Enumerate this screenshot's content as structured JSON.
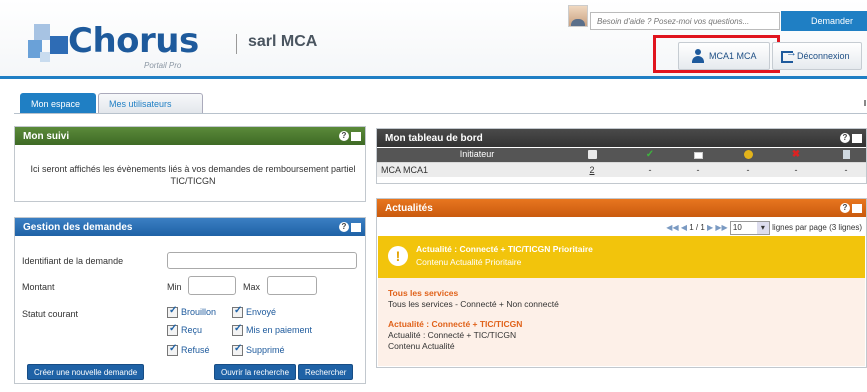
{
  "header": {
    "logo_text": "Chorus",
    "logo_subtitle": "Portail Pro",
    "company": "sarl MCA",
    "help_placeholder": "Besoin d'aide ? Posez-moi vos questions...",
    "help_button": "Demander",
    "user_name": "MCA1 MCA",
    "logout_label": "Déconnexion"
  },
  "tabs": [
    {
      "label": "Mon espace",
      "active": true
    },
    {
      "label": "Mes utilisateurs",
      "active": false
    }
  ],
  "mon_suivi": {
    "title": "Mon suivi",
    "message": "Ici seront affichés les évènements liés à vos demandes de remboursement partiel TIC/TICGN"
  },
  "gestion": {
    "title": "Gestion des demandes",
    "id_label": "Identifiant de la demande",
    "montant_label": "Montant",
    "min_label": "Min",
    "max_label": "Max",
    "statut_label": "Statut courant",
    "statuses": [
      "Brouillon",
      "Envoyé",
      "Reçu",
      "Mis en paiement",
      "Refusé",
      "Supprimé"
    ],
    "create_button": "Créer une nouvelle demande",
    "open_search_button": "Ouvrir la recherche",
    "search_button": "Rechercher"
  },
  "tableau": {
    "title": "Mon tableau de bord",
    "column_header": "Initiateur",
    "column_icons": [
      "document-icon",
      "check-icon",
      "mail-icon",
      "coins-icon",
      "cross-icon",
      "trash-icon"
    ],
    "rows": [
      {
        "initiateur": "MCA MCA1",
        "values": [
          "2",
          "-",
          "-",
          "-",
          "-",
          "-"
        ]
      }
    ]
  },
  "actualites": {
    "title": "Actualités",
    "pager_prefix": "◀◀ ◀ ",
    "pager_pages": "1 / 1",
    "pager_suffix": " ▶ ▶▶",
    "per_page_value": "10",
    "per_page_label": "lignes par page (3 lignes)",
    "priority_title": "Actualité : Connecté + TIC/TICGN Prioritaire",
    "priority_body": "Contenu Actualité Prioritaire",
    "items": [
      {
        "title": "Tous les services",
        "lines": [
          "Tous les services - Connecté + Non connecté"
        ]
      },
      {
        "title": "Actualité : Connecté + TIC/TICGN",
        "lines": [
          "Actualité : Connecté + TIC/TICGN",
          "Contenu Actualité"
        ]
      }
    ]
  },
  "colors": {
    "brand_blue": "#1f7fc4",
    "panel_green": "#4a7a30",
    "panel_blue": "#1f62a6",
    "panel_orange": "#d9661a",
    "priority_yellow": "#f2c40c",
    "highlight_red": "#e0141e"
  }
}
